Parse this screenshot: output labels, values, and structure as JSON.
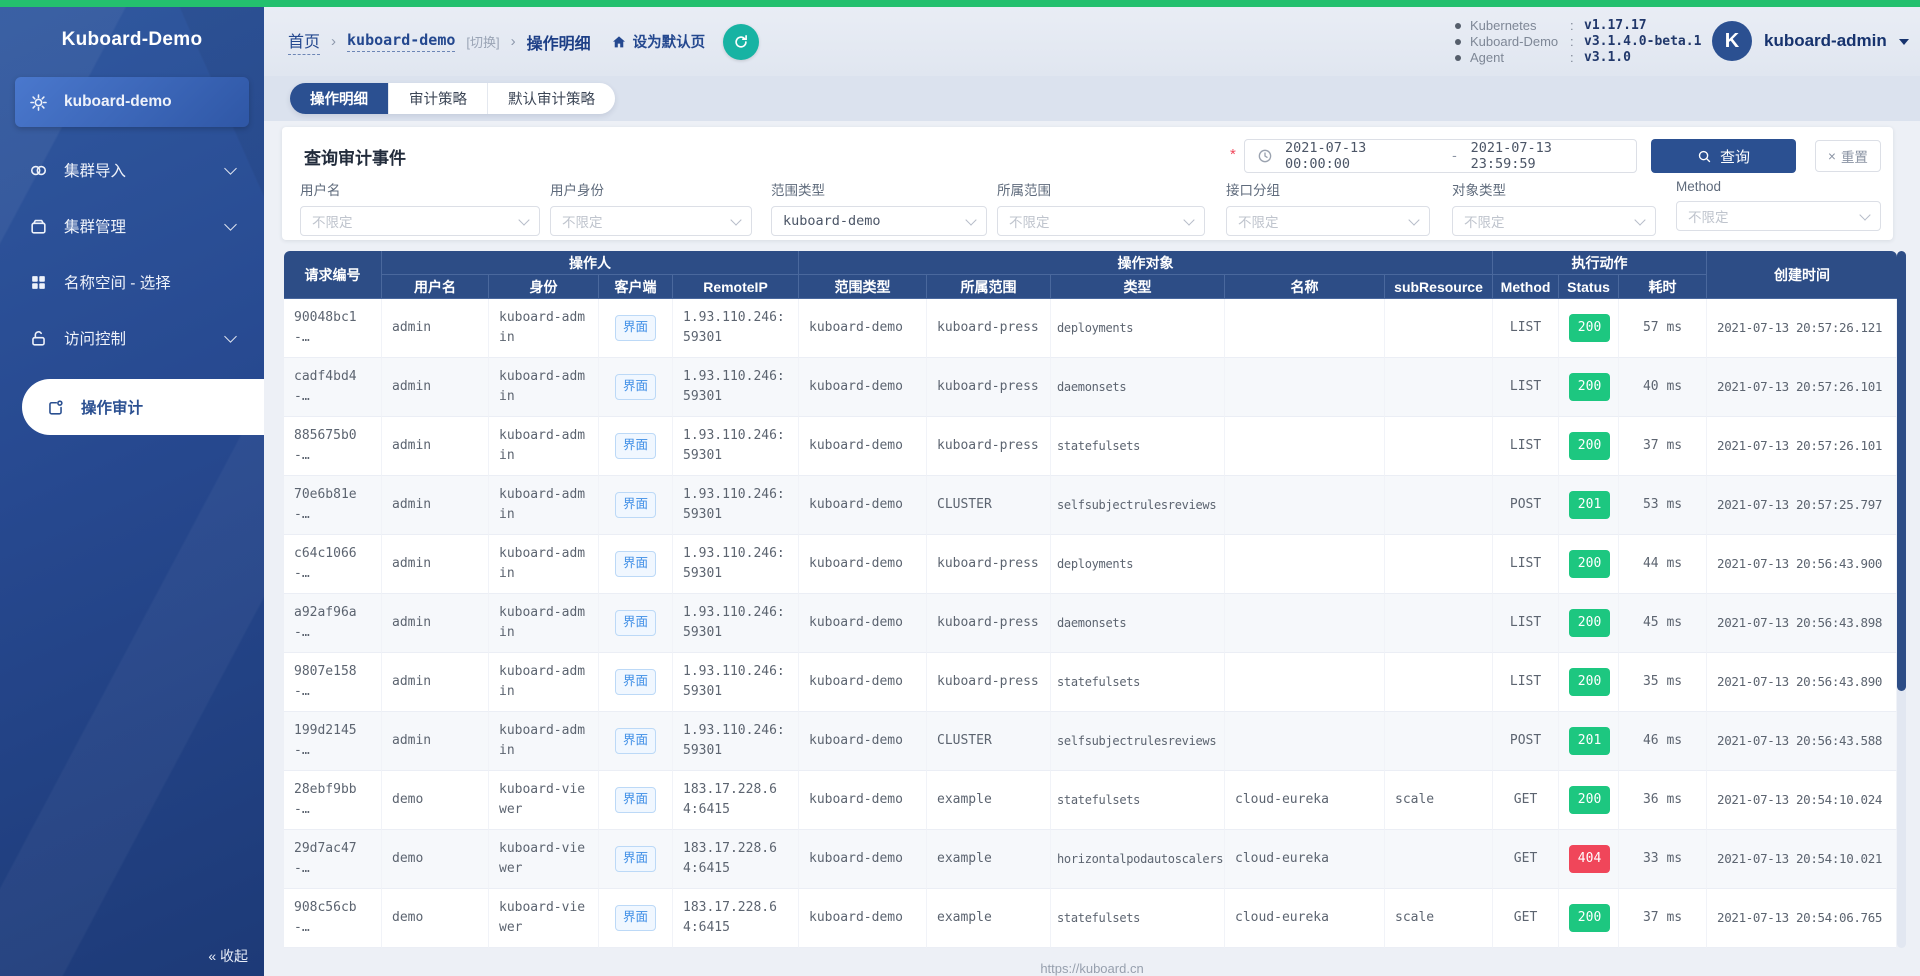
{
  "sidebar": {
    "title": "Kuboard-Demo",
    "items": [
      {
        "label": "kuboard-demo",
        "icon": "gear-icon",
        "state": "active"
      },
      {
        "label": "集群导入",
        "icon": "link-icon",
        "expandable": true
      },
      {
        "label": "集群管理",
        "icon": "box-icon",
        "expandable": true
      },
      {
        "label": "名称空间 - 选择",
        "icon": "grid-icon",
        "expandable": false
      },
      {
        "label": "访问控制",
        "icon": "lock-icon",
        "expandable": true
      },
      {
        "label": "操作审计",
        "icon": "audit-icon",
        "state": "current"
      }
    ],
    "collapse_label": "« 收起"
  },
  "header": {
    "breadcrumb": {
      "home": "首页",
      "separator": "›",
      "cluster": "kuboard-demo",
      "switch": "[切换]",
      "page": "操作明细"
    },
    "set_default_label": "设为默认页",
    "version_colon": ":",
    "versions": [
      {
        "label": "Kubernetes",
        "value": "v1.17.17"
      },
      {
        "label": "Kuboard-Demo",
        "value": "v3.1.4.0-beta.1"
      },
      {
        "label": "Agent",
        "value": "v3.1.0"
      }
    ],
    "user": {
      "avatar_letter": "K",
      "name": "kuboard-admin"
    }
  },
  "tabs": [
    {
      "label": "操作明细",
      "active": true
    },
    {
      "label": "审计策略",
      "active": false
    },
    {
      "label": "默认审计策略",
      "active": false
    }
  ],
  "filter": {
    "title": "查询审计事件",
    "required_mark": "*",
    "date_range": {
      "start": "2021-07-13 00:00:00",
      "separator": "-",
      "end": "2021-07-13 23:59:59"
    },
    "search_label": "查询",
    "reset_label": "重置",
    "reset_icon": "×",
    "fields": [
      {
        "label": "用户名",
        "placeholder": "不限定",
        "value": ""
      },
      {
        "label": "用户身份",
        "placeholder": "不限定",
        "value": ""
      },
      {
        "label": "范围类型",
        "placeholder": "",
        "value": "kuboard-demo"
      },
      {
        "label": "所属范围",
        "placeholder": "不限定",
        "value": ""
      },
      {
        "label": "接口分组",
        "placeholder": "不限定",
        "value": ""
      },
      {
        "label": "对象类型",
        "placeholder": "不限定",
        "value": ""
      },
      {
        "label": "Method",
        "placeholder": "不限定",
        "value": ""
      }
    ]
  },
  "table": {
    "col_request": "请求编号",
    "col_created": "创建时间",
    "groups": [
      {
        "label": "操作人"
      },
      {
        "label": "操作对象"
      },
      {
        "label": "执行动作"
      }
    ],
    "sub_columns": [
      "用户名",
      "身份",
      "客户端",
      "RemoteIP",
      "范围类型",
      "所属范围",
      "类型",
      "名称",
      "subResource",
      "Method",
      "Status",
      "耗时"
    ],
    "rows": [
      {
        "id": "90048bc1-…",
        "user": "admin",
        "identity": "kuboard-admin",
        "client": "界面",
        "remote_ip": "1.93.110.246:59301",
        "scope_type": "kuboard-demo",
        "scope": "kuboard-press",
        "kind": "deployments",
        "name": "",
        "sub_resource": "",
        "method": "LIST",
        "status": "200",
        "status_type": "success",
        "duration": "57 ms",
        "created": "2021-07-13 20:57:26.121"
      },
      {
        "id": "cadf4bd4-…",
        "user": "admin",
        "identity": "kuboard-admin",
        "client": "界面",
        "remote_ip": "1.93.110.246:59301",
        "scope_type": "kuboard-demo",
        "scope": "kuboard-press",
        "kind": "daemonsets",
        "name": "",
        "sub_resource": "",
        "method": "LIST",
        "status": "200",
        "status_type": "success",
        "duration": "40 ms",
        "created": "2021-07-13 20:57:26.101"
      },
      {
        "id": "885675b0-…",
        "user": "admin",
        "identity": "kuboard-admin",
        "client": "界面",
        "remote_ip": "1.93.110.246:59301",
        "scope_type": "kuboard-demo",
        "scope": "kuboard-press",
        "kind": "statefulsets",
        "name": "",
        "sub_resource": "",
        "method": "LIST",
        "status": "200",
        "status_type": "success",
        "duration": "37 ms",
        "created": "2021-07-13 20:57:26.101"
      },
      {
        "id": "70e6b81e-…",
        "user": "admin",
        "identity": "kuboard-admin",
        "client": "界面",
        "remote_ip": "1.93.110.246:59301",
        "scope_type": "kuboard-demo",
        "scope": "CLUSTER",
        "kind": "selfsubjectrulesreviews",
        "name": "",
        "sub_resource": "",
        "method": "POST",
        "status": "201",
        "status_type": "success",
        "duration": "53 ms",
        "created": "2021-07-13 20:57:25.797"
      },
      {
        "id": "c64c1066-…",
        "user": "admin",
        "identity": "kuboard-admin",
        "client": "界面",
        "remote_ip": "1.93.110.246:59301",
        "scope_type": "kuboard-demo",
        "scope": "kuboard-press",
        "kind": "deployments",
        "name": "",
        "sub_resource": "",
        "method": "LIST",
        "status": "200",
        "status_type": "success",
        "duration": "44 ms",
        "created": "2021-07-13 20:56:43.900"
      },
      {
        "id": "a92af96a-…",
        "user": "admin",
        "identity": "kuboard-admin",
        "client": "界面",
        "remote_ip": "1.93.110.246:59301",
        "scope_type": "kuboard-demo",
        "scope": "kuboard-press",
        "kind": "daemonsets",
        "name": "",
        "sub_resource": "",
        "method": "LIST",
        "status": "200",
        "status_type": "success",
        "duration": "45 ms",
        "created": "2021-07-13 20:56:43.898"
      },
      {
        "id": "9807e158-…",
        "user": "admin",
        "identity": "kuboard-admin",
        "client": "界面",
        "remote_ip": "1.93.110.246:59301",
        "scope_type": "kuboard-demo",
        "scope": "kuboard-press",
        "kind": "statefulsets",
        "name": "",
        "sub_resource": "",
        "method": "LIST",
        "status": "200",
        "status_type": "success",
        "duration": "35 ms",
        "created": "2021-07-13 20:56:43.890"
      },
      {
        "id": "199d2145-…",
        "user": "admin",
        "identity": "kuboard-admin",
        "client": "界面",
        "remote_ip": "1.93.110.246:59301",
        "scope_type": "kuboard-demo",
        "scope": "CLUSTER",
        "kind": "selfsubjectrulesreviews",
        "name": "",
        "sub_resource": "",
        "method": "POST",
        "status": "201",
        "status_type": "success",
        "duration": "46 ms",
        "created": "2021-07-13 20:56:43.588"
      },
      {
        "id": "28ebf9bb-…",
        "user": "demo",
        "identity": "kuboard-viewer",
        "client": "界面",
        "remote_ip": "183.17.228.64:6415",
        "scope_type": "kuboard-demo",
        "scope": "example",
        "kind": "statefulsets",
        "name": "cloud-eureka",
        "sub_resource": "scale",
        "method": "GET",
        "status": "200",
        "status_type": "success",
        "duration": "36 ms",
        "created": "2021-07-13 20:54:10.024"
      },
      {
        "id": "29d7ac47-…",
        "user": "demo",
        "identity": "kuboard-viewer",
        "client": "界面",
        "remote_ip": "183.17.228.64:6415",
        "scope_type": "kuboard-demo",
        "scope": "example",
        "kind": "horizontalpodautoscalers",
        "name": "cloud-eureka",
        "sub_resource": "",
        "method": "GET",
        "status": "404",
        "status_type": "danger",
        "duration": "33 ms",
        "created": "2021-07-13 20:54:10.021"
      },
      {
        "id": "908c56cb-…",
        "user": "demo",
        "identity": "kuboard-viewer",
        "client": "界面",
        "remote_ip": "183.17.228.64:6415",
        "scope_type": "kuboard-demo",
        "scope": "example",
        "kind": "statefulsets",
        "name": "cloud-eureka",
        "sub_resource": "scale",
        "method": "GET",
        "status": "200",
        "status_type": "success",
        "duration": "37 ms",
        "created": "2021-07-13 20:54:06.765"
      }
    ]
  },
  "footer": {
    "url": "https://kuboard.cn"
  },
  "colors": {
    "topbar_green": "#24c06e",
    "refresh_teal": "#17b3a3",
    "primary_navy": "#2b5091",
    "table_header_navy": "#2d4d86",
    "status_success": "#1dc780",
    "status_danger": "#f0465a",
    "tag_blue": "#3e8ee6"
  }
}
